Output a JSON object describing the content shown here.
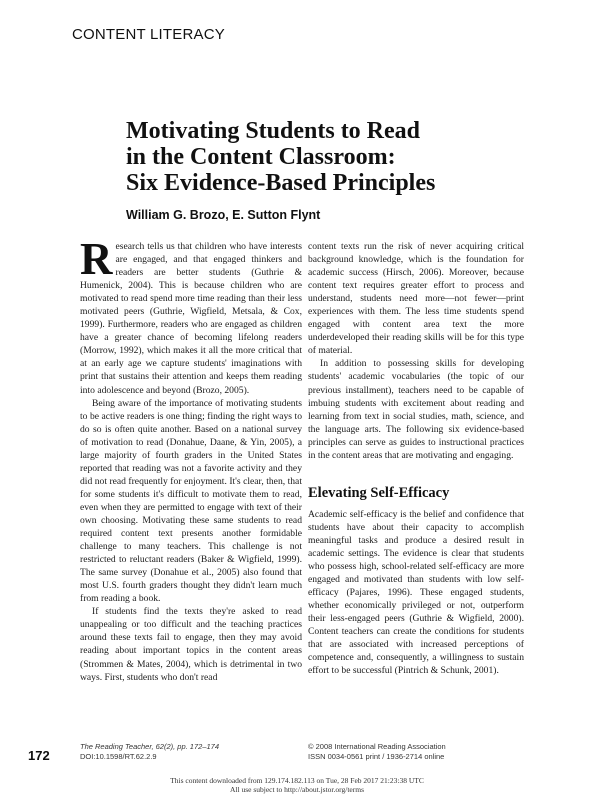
{
  "section_label": "CONTENT LITERACY",
  "title": {
    "line1": "Motivating Students to Read",
    "line2": "in the Content Classroom:",
    "line3": "Six Evidence-Based Principles"
  },
  "authors": "William G. Brozo, E. Sutton Flynt",
  "left_column": {
    "dropcap": "R",
    "p1": "esearch tells us that children who have interests are engaged, and that engaged thinkers and readers are better students (Guthrie & Humenick, 2004). This is because children who are motivated to read spend more time reading than their less motivated peers (Guthrie, Wigfield, Metsala, & Cox, 1999). Furthermore, readers who are engaged as children have a greater chance of becoming lifelong readers (Morrow, 1992), which makes it all the more critical that at an early age we capture students' imaginations with print that sustains their attention and keeps them reading into adolescence and beyond (Brozo, 2005).",
    "p2": "Being aware of the importance of motivating students to be active readers is one thing; finding the right ways to do so is often quite another. Based on a national survey of motivation to read (Donahue, Daane, & Yin, 2005), a large majority of fourth graders in the United States reported that reading was not a favorite activity and they did not read frequently for enjoyment. It's clear, then, that for some students it's difficult to motivate them to read, even when they are permitted to engage with text of their own choosing. Motivating these same students to read required content text presents another formidable challenge to many teachers. This challenge is not restricted to reluctant readers (Baker & Wigfield, 1999). The same survey (Donahue et al., 2005) also found that most U.S. fourth graders thought they didn't learn much from reading a book.",
    "p3": "If students find the texts they're asked to read unappealing or too difficult and the teaching practices around these texts fail to engage, then they may avoid reading about important topics in the content areas (Strommen & Mates, 2004), which is detrimental in two ways. First, students who don't read"
  },
  "right_column": {
    "p1": "content texts run the risk of never acquiring critical background knowledge, which is the foundation for academic success (Hirsch, 2006). Moreover, because content text requires greater effort to process and understand, students need more—not fewer—print experiences with them. The less time students spend engaged with content area text the more underdeveloped their reading skills will be for this type of material.",
    "p2": "In addition to possessing skills for developing students' academic vocabularies (the topic of our previous installment), teachers need to be capable of imbuing students with excitement about reading and learning from text in social studies, math, science, and the language arts. The following six evidence-based principles can serve as guides to instructional practices in the content areas that are motivating and engaging.",
    "heading": "Elevating Self-Efficacy",
    "p3": "Academic self-efficacy is the belief and confidence that students have about their capacity to accomplish meaningful tasks and produce a desired result in academic settings. The evidence is clear that students who possess high, school-related self-efficacy are more engaged and motivated than students with low self-efficacy (Pajares, 1996). These engaged students, whether economically privileged or not, outperform their less-engaged peers (Guthrie & Wigfield, 2000). Content teachers can create the conditions for students that are associated with increased perceptions of competence and, consequently, a willingness to sustain effort to be successful (Pintrich & Schunk, 2001)."
  },
  "footer": {
    "page_number": "172",
    "journal": "The Reading Teacher, 62(2), pp. 172–174",
    "doi": "DOI:10.1598/RT.62.2.9",
    "copyright": "© 2008 International Reading Association",
    "issn": "ISSN 0034-0561 print / 1936-2714 online"
  },
  "jstor": {
    "line1": "This content downloaded from 129.174.182.113 on Tue, 28 Feb 2017 21:23:38 UTC",
    "line2": "All use subject to http://about.jstor.org/terms"
  }
}
